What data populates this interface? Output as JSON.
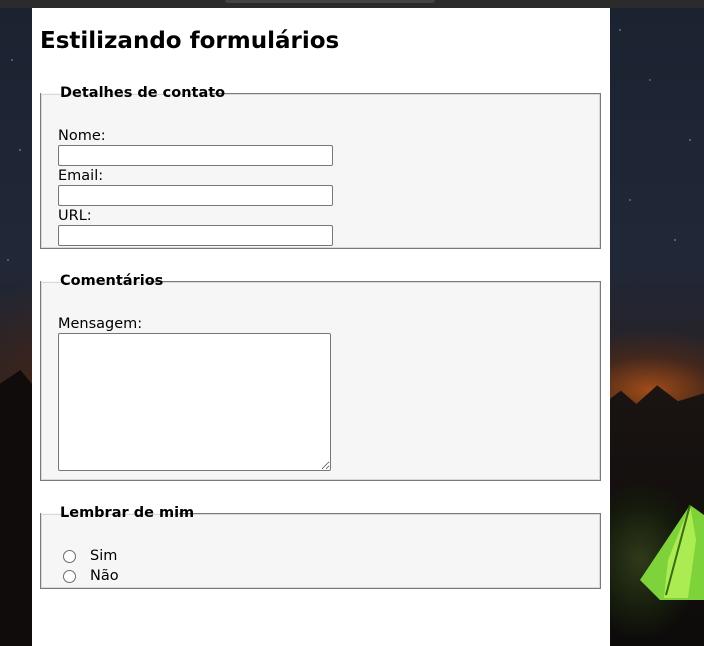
{
  "page": {
    "title": "Estilizando formulários"
  },
  "contact": {
    "legend": "Detalhes de contato",
    "name_label": "Nome:",
    "name_value": "",
    "email_label": "Email:",
    "email_value": "",
    "url_label": "URL:",
    "url_value": ""
  },
  "comments": {
    "legend": "Comentários",
    "message_label": "Mensagem:",
    "message_value": ""
  },
  "remember": {
    "legend": "Lembrar de mim",
    "options": [
      {
        "label": "Sim",
        "selected": false
      },
      {
        "label": "Não",
        "selected": false
      }
    ]
  }
}
